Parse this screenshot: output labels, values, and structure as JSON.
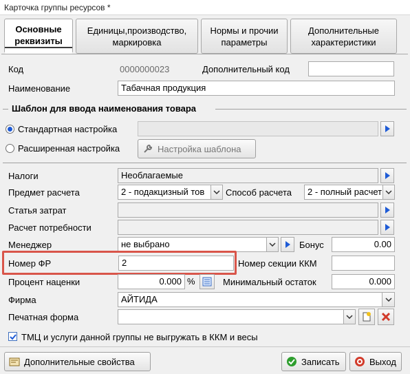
{
  "window": {
    "title": "Карточка группы ресурсов *"
  },
  "tabs": [
    {
      "label": "Основные реквизиты",
      "active": true
    },
    {
      "label": "Единицы,производство, маркировка",
      "active": false
    },
    {
      "label": "Нормы и прочии параметры",
      "active": false
    },
    {
      "label": "Дополнительные характеристики",
      "active": false
    }
  ],
  "fields": {
    "code_label": "Код",
    "code_value": "0000000023",
    "extra_code_label": "Дополнительный код",
    "extra_code_value": "",
    "name_label": "Наименование",
    "name_value": "Табачная продукция"
  },
  "template": {
    "section_title": "Шаблон для ввода наименования товара",
    "standard_label": "Стандартная настройка",
    "extended_label": "Расширенная настройка",
    "template_button": "Настройка шаблона",
    "standard_value": ""
  },
  "params": {
    "taxes_label": "Налоги",
    "taxes_value": "Необлагаемые",
    "subject_label": "Предмет расчета",
    "subject_value": "2 - подакцизный тов",
    "method_label": "Способ расчета",
    "method_value": "2 - полный расчет",
    "cost_label": "Статья затрат",
    "cost_value": "",
    "demand_label": "Расчет потребности",
    "demand_value": "",
    "manager_label": "Менеджер",
    "manager_value": "не выбрано",
    "bonus_label": "Бонус",
    "bonus_value": "0.00",
    "fr_label": "Номер ФР",
    "fr_value": "2",
    "kkm_label": "Номер секции ККМ",
    "kkm_value": "",
    "markup_label": "Процент наценки",
    "markup_value": "0.000",
    "markup_unit": "%",
    "minstock_label": "Минимальный остаток",
    "minstock_value": "0.000",
    "firm_label": "Фирма",
    "firm_value": "АЙТИДА",
    "print_label": "Печатная форма",
    "print_value": ""
  },
  "checkbox": {
    "label": "ТМЦ и услуги данной группы не выгружать в ККМ и весы",
    "checked": true
  },
  "footer": {
    "extra_props": "Дополнительные свойства",
    "save": "Записать",
    "exit": "Выход"
  },
  "colors": {
    "accent_blue": "#1e5bd6",
    "highlight": "#d9554a",
    "ok_green": "#2e9e2e",
    "exit_red": "#d23b2b"
  },
  "icons": [
    "wrench-icon",
    "arrow-right-icon",
    "chevron-down-icon",
    "calculator-icon",
    "new-document-icon",
    "delete-icon",
    "save-icon",
    "exit-icon",
    "properties-icon"
  ]
}
